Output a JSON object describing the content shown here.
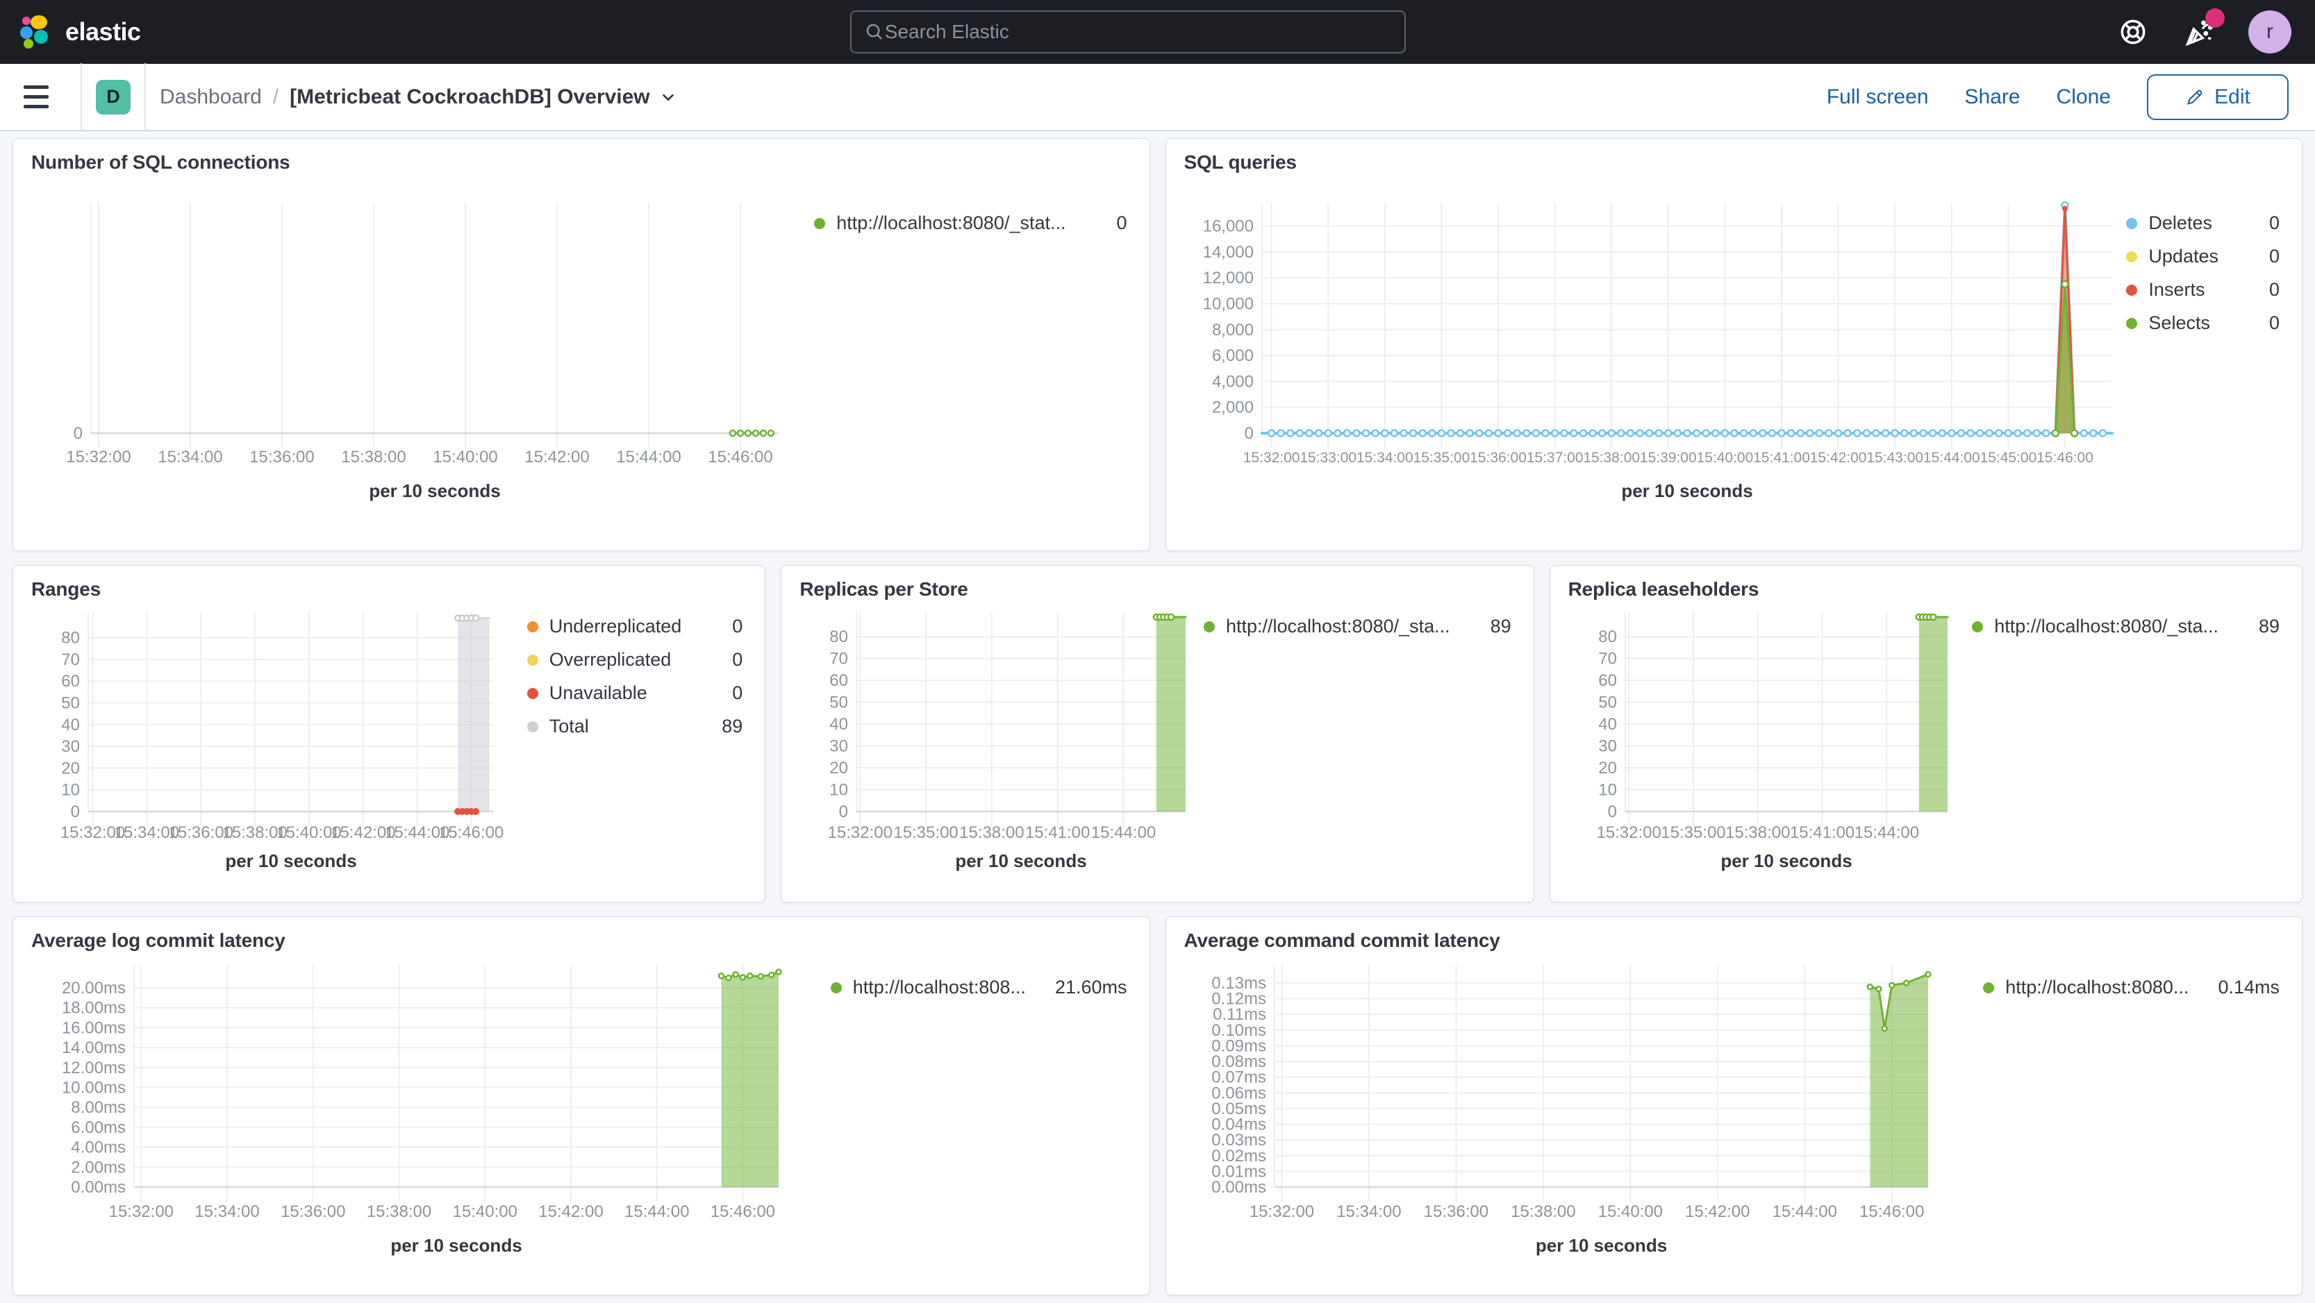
{
  "header": {
    "logo_text": "elastic",
    "search_placeholder": "Search Elastic",
    "avatar_initial": "r"
  },
  "toolbar": {
    "space_initial": "D",
    "breadcrumb_root": "Dashboard",
    "breadcrumb_separator": "/",
    "title": "[Metricbeat CockroachDB] Overview",
    "actions": {
      "full_screen": "Full screen",
      "share": "Share",
      "clone": "Clone",
      "edit": "Edit"
    }
  },
  "colors": {
    "green": "#6EB32F",
    "blue": "#70C6EC",
    "yellow": "#F0DB55",
    "red": "#E4533F",
    "orange": "#F0902E",
    "pale_yellow": "#F3D25A",
    "gray": "#CDCFD4",
    "accent_pink": "#DD2E79",
    "link_blue": "#195F9E",
    "space_teal": "#50BFA6"
  },
  "panels": [
    {
      "id": "sql-connections",
      "title": "Number of SQL connections",
      "axis": {
        "x_label": "per 10 seconds",
        "x_domain": [
          "15:31:50",
          "15:46:50"
        ],
        "x_ticks": [
          "15:32:00",
          "15:34:00",
          "15:36:00",
          "15:38:00",
          "15:40:00",
          "15:42:00",
          "15:44:00",
          "15:46:00"
        ],
        "y_max": 10,
        "y_ticks": [
          {
            "v": 0,
            "label": "0"
          }
        ]
      },
      "legend": [
        {
          "label": "http://localhost:8080/_stat...",
          "value": "0",
          "color": "#6EB32F"
        }
      ],
      "series": [
        {
          "name": "http://localhost:8080/_stat...",
          "color": "#6EB32F",
          "type": "line",
          "width": 3,
          "dash": "6,7",
          "points": [
            {
              "t": "15:45:50",
              "v": 0
            },
            {
              "t": "15:46:40",
              "v": 0
            }
          ],
          "markers": {
            "mode": "interval",
            "every_s": 10,
            "from": "15:45:50",
            "to": "15:46:40",
            "style": "open",
            "r": 4
          }
        }
      ]
    },
    {
      "id": "sql-queries",
      "title": "SQL queries",
      "axis": {
        "x_label": "per 10 seconds",
        "x_domain": [
          "15:31:50",
          "15:46:50"
        ],
        "x_ticks": [
          "15:32:00",
          "15:33:00",
          "15:34:00",
          "15:35:00",
          "15:36:00",
          "15:37:00",
          "15:38:00",
          "15:39:00",
          "15:40:00",
          "15:41:00",
          "15:42:00",
          "15:43:00",
          "15:44:00",
          "15:45:00",
          "15:46:00"
        ],
        "y_max": 17800,
        "y_ticks": [
          {
            "v": 0,
            "label": "0"
          },
          {
            "v": 2000,
            "label": "2,000"
          },
          {
            "v": 4000,
            "label": "4,000"
          },
          {
            "v": 6000,
            "label": "6,000"
          },
          {
            "v": 8000,
            "label": "8,000"
          },
          {
            "v": 10000,
            "label": "10,000"
          },
          {
            "v": 12000,
            "label": "12,000"
          },
          {
            "v": 14000,
            "label": "14,000"
          },
          {
            "v": 16000,
            "label": "16,000"
          }
        ]
      },
      "legend": [
        {
          "label": "Deletes",
          "value": "0",
          "color": "#70C6EC"
        },
        {
          "label": "Updates",
          "value": "0",
          "color": "#F0DB55"
        },
        {
          "label": "Inserts",
          "value": "0",
          "color": "#E4533F"
        },
        {
          "label": "Selects",
          "value": "0",
          "color": "#6EB32F"
        }
      ],
      "series": [
        {
          "name": "Deletes",
          "color": "#70C6EC",
          "type": "line",
          "width": 4,
          "points": [
            {
              "t": "15:31:50",
              "v": 0
            },
            {
              "t": "15:45:50",
              "v": 0
            },
            {
              "t": "15:46:00",
              "v": 17600
            },
            {
              "t": "15:46:10",
              "v": 0
            },
            {
              "t": "15:46:50",
              "v": 0
            }
          ],
          "markers": {
            "mode": "interval",
            "every_s": 10,
            "from": "15:32:00",
            "to": "15:46:40",
            "style": "open",
            "r": 4.5
          }
        },
        {
          "name": "Updates",
          "color": "#F0DB55",
          "type": "line",
          "width": 3,
          "points": [
            {
              "t": "15:45:50",
              "v": 0
            },
            {
              "t": "15:46:00",
              "v": 16900
            },
            {
              "t": "15:46:10",
              "v": 0
            }
          ]
        },
        {
          "name": "Inserts",
          "color": "#E4533F",
          "type": "area",
          "fill_opacity": 0.5,
          "width": 3,
          "points": [
            {
              "t": "15:45:50",
              "v": 0
            },
            {
              "t": "15:46:00",
              "v": 17350
            },
            {
              "t": "15:46:10",
              "v": 0
            }
          ],
          "markers": {
            "mode": "points",
            "style": "solid",
            "r": 4
          }
        },
        {
          "name": "Selects",
          "color": "#6EB32F",
          "type": "area",
          "fill_opacity": 0.6,
          "width": 3,
          "points": [
            {
              "t": "15:45:50",
              "v": 0
            },
            {
              "t": "15:46:00",
              "v": 11500
            },
            {
              "t": "15:46:10",
              "v": 0
            }
          ],
          "markers": {
            "mode": "points",
            "style": "open",
            "r": 4.5
          }
        }
      ]
    },
    {
      "id": "ranges",
      "title": "Ranges",
      "axis": {
        "x_label": "per 10 seconds",
        "x_domain": [
          "15:31:50",
          "15:46:50"
        ],
        "x_ticks": [
          "15:32:00",
          "15:34:00",
          "15:36:00",
          "15:38:00",
          "15:40:00",
          "15:42:00",
          "15:44:00",
          "15:46:00"
        ],
        "y_max": 92,
        "y_ticks": [
          {
            "v": 0,
            "label": "0"
          },
          {
            "v": 10,
            "label": "10"
          },
          {
            "v": 20,
            "label": "20"
          },
          {
            "v": 30,
            "label": "30"
          },
          {
            "v": 40,
            "label": "40"
          },
          {
            "v": 50,
            "label": "50"
          },
          {
            "v": 60,
            "label": "60"
          },
          {
            "v": 70,
            "label": "70"
          },
          {
            "v": 80,
            "label": "80"
          }
        ]
      },
      "legend": [
        {
          "label": "Underreplicated",
          "value": "0",
          "color": "#F0902E"
        },
        {
          "label": "Overreplicated",
          "value": "0",
          "color": "#F3D25A"
        },
        {
          "label": "Unavailable",
          "value": "0",
          "color": "#E4533F"
        },
        {
          "label": "Total",
          "value": "89",
          "color": "#CDCFD4"
        }
      ],
      "series": [
        {
          "name": "Total",
          "color": "#C9CCD2",
          "type": "area",
          "fill_opacity": 0.5,
          "width": 2,
          "points": [
            {
              "t": "15:45:30",
              "v": 89
            },
            {
              "t": "15:46:40",
              "v": 89
            }
          ],
          "markers": {
            "mode": "interval",
            "every_s": 10,
            "from": "15:45:30",
            "to": "15:46:10",
            "style": "open",
            "r": 4
          }
        },
        {
          "name": "Underreplicated",
          "color": "#F0902E",
          "type": "line",
          "width": 3,
          "points": [
            {
              "t": "15:45:30",
              "v": 0
            },
            {
              "t": "15:46:10",
              "v": 0
            }
          ]
        },
        {
          "name": "Overreplicated",
          "color": "#F3D25A",
          "type": "line",
          "width": 3,
          "points": [
            {
              "t": "15:45:30",
              "v": 0
            },
            {
              "t": "15:46:10",
              "v": 0
            }
          ]
        },
        {
          "name": "Unavailable",
          "color": "#E4533F",
          "type": "line",
          "width": 3,
          "points": [
            {
              "t": "15:45:30",
              "v": 0
            },
            {
              "t": "15:46:10",
              "v": 0
            }
          ],
          "markers": {
            "mode": "interval",
            "every_s": 10,
            "from": "15:45:30",
            "to": "15:46:10",
            "style": "solid",
            "r": 5
          }
        }
      ]
    },
    {
      "id": "replicas-per-store",
      "title": "Replicas per Store",
      "axis": {
        "x_label": "per 10 seconds",
        "x_domain": [
          "15:31:50",
          "15:46:50"
        ],
        "x_ticks": [
          "15:32:00",
          "15:35:00",
          "15:38:00",
          "15:41:00",
          "15:44:00"
        ],
        "y_max": 91.5,
        "y_ticks": [
          {
            "v": 0,
            "label": "0"
          },
          {
            "v": 10,
            "label": "10"
          },
          {
            "v": 20,
            "label": "20"
          },
          {
            "v": 30,
            "label": "30"
          },
          {
            "v": 40,
            "label": "40"
          },
          {
            "v": 50,
            "label": "50"
          },
          {
            "v": 60,
            "label": "60"
          },
          {
            "v": 70,
            "label": "70"
          },
          {
            "v": 80,
            "label": "80"
          }
        ]
      },
      "legend": [
        {
          "label": "http://localhost:8080/_sta...",
          "value": "89",
          "color": "#6EB32F"
        }
      ],
      "series": [
        {
          "name": "http://localhost:8080/_sta...",
          "color": "#6EB32F",
          "type": "area",
          "fill_opacity": 0.5,
          "width": 3,
          "points": [
            {
              "t": "15:45:30",
              "v": 89
            },
            {
              "t": "15:46:50",
              "v": 89
            }
          ],
          "markers": {
            "mode": "interval",
            "every_s": 10,
            "from": "15:45:30",
            "to": "15:46:10",
            "style": "open",
            "r": 4
          }
        }
      ]
    },
    {
      "id": "replica-leaseholders",
      "title": "Replica leaseholders",
      "axis": {
        "x_label": "per 10 seconds",
        "x_domain": [
          "15:31:50",
          "15:46:50"
        ],
        "x_ticks": [
          "15:32:00",
          "15:35:00",
          "15:38:00",
          "15:41:00",
          "15:44:00"
        ],
        "y_max": 91.5,
        "y_ticks": [
          {
            "v": 0,
            "label": "0"
          },
          {
            "v": 10,
            "label": "10"
          },
          {
            "v": 20,
            "label": "20"
          },
          {
            "v": 30,
            "label": "30"
          },
          {
            "v": 40,
            "label": "40"
          },
          {
            "v": 50,
            "label": "50"
          },
          {
            "v": 60,
            "label": "60"
          },
          {
            "v": 70,
            "label": "70"
          },
          {
            "v": 80,
            "label": "80"
          }
        ]
      },
      "legend": [
        {
          "label": "http://localhost:8080/_sta...",
          "value": "89",
          "color": "#6EB32F"
        }
      ],
      "series": [
        {
          "name": "http://localhost:8080/_sta...",
          "color": "#6EB32F",
          "type": "area",
          "fill_opacity": 0.5,
          "width": 3,
          "points": [
            {
              "t": "15:45:30",
              "v": 89
            },
            {
              "t": "15:46:50",
              "v": 89
            }
          ],
          "markers": {
            "mode": "interval",
            "every_s": 10,
            "from": "15:45:30",
            "to": "15:46:10",
            "style": "open",
            "r": 4
          }
        }
      ]
    },
    {
      "id": "avg-log-commit-latency",
      "title": "Average log commit latency",
      "axis": {
        "x_label": "per 10 seconds",
        "x_domain": [
          "15:31:50",
          "15:46:50"
        ],
        "x_ticks": [
          "15:32:00",
          "15:34:00",
          "15:36:00",
          "15:38:00",
          "15:40:00",
          "15:42:00",
          "15:44:00",
          "15:46:00"
        ],
        "y_max": 22.3,
        "y_ticks": [
          {
            "v": 0,
            "label": "0.00ms"
          },
          {
            "v": 2,
            "label": "2.00ms"
          },
          {
            "v": 4,
            "label": "4.00ms"
          },
          {
            "v": 6,
            "label": "6.00ms"
          },
          {
            "v": 8,
            "label": "8.00ms"
          },
          {
            "v": 10,
            "label": "10.00ms"
          },
          {
            "v": 12,
            "label": "12.00ms"
          },
          {
            "v": 14,
            "label": "14.00ms"
          },
          {
            "v": 16,
            "label": "16.00ms"
          },
          {
            "v": 18,
            "label": "18.00ms"
          },
          {
            "v": 20,
            "label": "20.00ms"
          }
        ]
      },
      "legend": [
        {
          "label": "http://localhost:808...",
          "value": "21.60ms",
          "color": "#6EB32F"
        }
      ],
      "series": [
        {
          "name": "http://localhost:808...",
          "color": "#6EB32F",
          "type": "area",
          "fill_opacity": 0.5,
          "width": 3,
          "points": [
            {
              "t": "15:45:30",
              "v": 21.2
            },
            {
              "t": "15:45:40",
              "v": 21.0
            },
            {
              "t": "15:45:50",
              "v": 21.35
            },
            {
              "t": "15:46:00",
              "v": 21.05
            },
            {
              "t": "15:46:10",
              "v": 21.2
            },
            {
              "t": "15:46:25",
              "v": 21.15
            },
            {
              "t": "15:46:40",
              "v": 21.3
            },
            {
              "t": "15:46:50",
              "v": 21.6
            }
          ],
          "markers": {
            "mode": "points",
            "style": "open",
            "r": 3.5
          }
        }
      ]
    },
    {
      "id": "avg-command-commit-latency",
      "title": "Average command commit latency",
      "axis": {
        "x_label": "per 10 seconds",
        "x_domain": [
          "15:31:50",
          "15:46:50"
        ],
        "x_ticks": [
          "15:32:00",
          "15:34:00",
          "15:36:00",
          "15:38:00",
          "15:40:00",
          "15:42:00",
          "15:44:00",
          "15:46:00"
        ],
        "y_max": 0.1415,
        "y_ticks": [
          {
            "v": 0,
            "label": "0.00ms"
          },
          {
            "v": 0.01,
            "label": "0.01ms"
          },
          {
            "v": 0.02,
            "label": "0.02ms"
          },
          {
            "v": 0.03,
            "label": "0.03ms"
          },
          {
            "v": 0.04,
            "label": "0.04ms"
          },
          {
            "v": 0.05,
            "label": "0.05ms"
          },
          {
            "v": 0.06,
            "label": "0.06ms"
          },
          {
            "v": 0.07,
            "label": "0.07ms"
          },
          {
            "v": 0.08,
            "label": "0.08ms"
          },
          {
            "v": 0.09,
            "label": "0.09ms"
          },
          {
            "v": 0.1,
            "label": "0.10ms"
          },
          {
            "v": 0.11,
            "label": "0.11ms"
          },
          {
            "v": 0.12,
            "label": "0.12ms"
          },
          {
            "v": 0.13,
            "label": "0.13ms"
          }
        ]
      },
      "legend": [
        {
          "label": "http://localhost:8080...",
          "value": "0.14ms",
          "color": "#6EB32F"
        }
      ],
      "series": [
        {
          "name": "http://localhost:8080...",
          "color": "#6EB32F",
          "type": "area",
          "fill_opacity": 0.5,
          "width": 3,
          "points": [
            {
              "t": "15:45:30",
              "v": 0.1275
            },
            {
              "t": "15:45:42",
              "v": 0.1262
            },
            {
              "t": "15:45:50",
              "v": 0.101
            },
            {
              "t": "15:46:00",
              "v": 0.1285
            },
            {
              "t": "15:46:20",
              "v": 0.13
            },
            {
              "t": "15:46:50",
              "v": 0.1355
            }
          ],
          "markers": {
            "mode": "points",
            "style": "open",
            "r": 3.5
          }
        }
      ]
    }
  ]
}
